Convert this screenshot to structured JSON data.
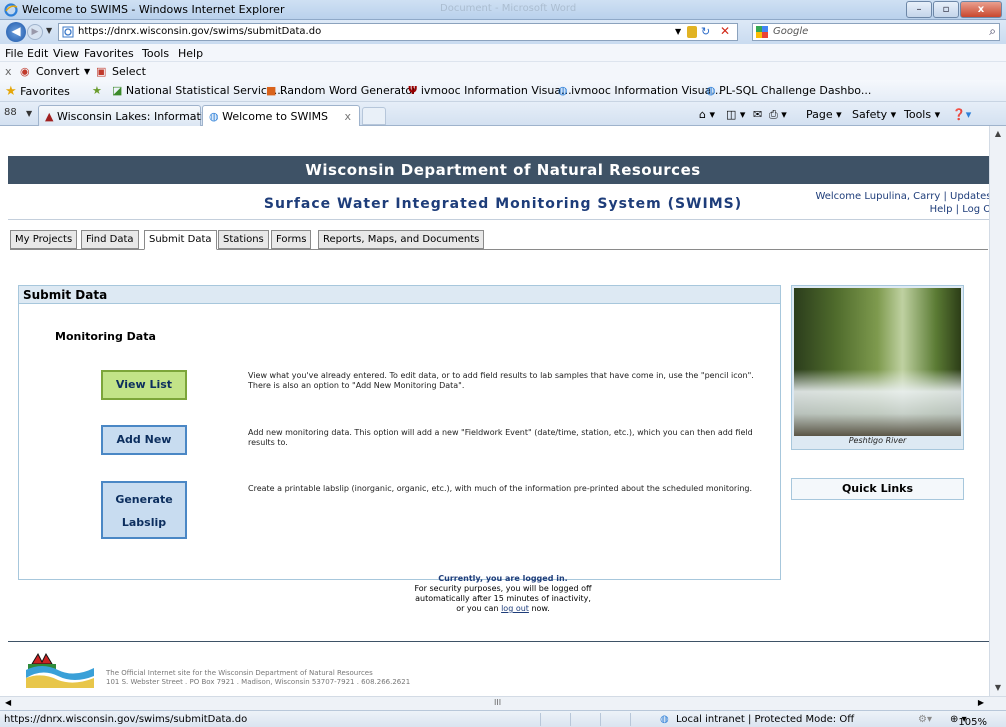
{
  "window": {
    "title": "Welcome to SWIMS - Windows Internet Explorer",
    "blurred_title": "Document - Microsoft Word",
    "minimize": "–",
    "maximize": "▫",
    "close": "x"
  },
  "address": {
    "url": "https://dnrx.wisconsin.gov/swims/submitData.do",
    "search_placeholder": "Google"
  },
  "menu": [
    "File",
    "Edit",
    "View",
    "Favorites",
    "Tools",
    "Help"
  ],
  "convert_bar": {
    "close": "x",
    "convert": "Convert",
    "select": "Select"
  },
  "favorites": {
    "label": "Favorites",
    "items": [
      "National Statistical Service...",
      "Random Word Generator",
      "ivmooc Information Visua...",
      "ivmooc Information Visua...",
      "PL-SQL Challenge Dashbo..."
    ]
  },
  "browser_tabs": {
    "quick_tabs": "88",
    "tabs": [
      {
        "label": "Wisconsin Lakes: Informati..."
      },
      {
        "label": "Welcome to SWIMS",
        "close": "x"
      }
    ],
    "commands": [
      "Page ▾",
      "Safety ▾",
      "Tools ▾"
    ]
  },
  "site": {
    "banner": "Wisconsin Department of Natural Resources",
    "app_title": "Surface Water Integrated Monitoring System (SWIMS)",
    "welcome": "Welcome Lupulina, Carry",
    "updates": "Updates",
    "help": "Help",
    "logoff": "Log Off",
    "sep": "|"
  },
  "nav_tabs": [
    "My Projects",
    "Find Data",
    "Submit Data",
    "Stations",
    "Forms",
    "Reports, Maps, and Documents"
  ],
  "submit": {
    "header": "Submit Data",
    "section_title": "Monitoring Data",
    "actions": [
      {
        "label": "View List",
        "desc": "View what you've already entered. To edit data, or to add field results to lab samples that have come in, use the \"pencil icon\". There is also an option to \"Add New Monitoring Data\"."
      },
      {
        "label": "Add New",
        "desc": "Add new monitoring data. This option will add a new \"Fieldwork Event\" (date/time, station, etc.), which you can then add field results to."
      },
      {
        "label_line1": "Generate",
        "label_line2": "Labslip",
        "desc": "Create a printable labslip (inorganic, organic, etc.), with much of the information pre-printed about the scheduled monitoring."
      }
    ]
  },
  "sidebar": {
    "photo_caption": "Peshtigo River",
    "quick_links": "Quick Links"
  },
  "login_note": {
    "line1": "Currently, you are logged in.",
    "line2": "For security purposes, you will be logged off",
    "line3": "automatically after 15 minutes of inactivity,",
    "line4_pre": "or you can",
    "logout_link": "log out",
    "line4_post": "now."
  },
  "footer": {
    "line1": "The Official Internet site for the Wisconsin Department of Natural Resources",
    "line2": "101 S. Webster Street . PO Box 7921 . Madison, Wisconsin 53707-7921 . 608.266.2621"
  },
  "status": {
    "url": "https://dnrx.wisconsin.gov/swims/submitData.do",
    "zone": "Local intranet | Protected Mode: Off",
    "zoom": "105%"
  },
  "scroll": {
    "grip": "III"
  },
  "colors": {
    "banner_bg": "#3e5266",
    "title_blue": "#1e3d7a",
    "btn_green": "#c2e388",
    "btn_blue": "#c8dcf0"
  }
}
